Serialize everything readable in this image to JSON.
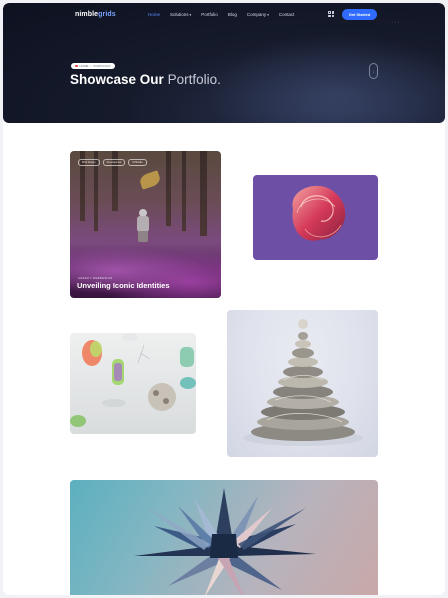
{
  "brand": {
    "name_a": "nimble",
    "name_b": "grids"
  },
  "nav": {
    "items": [
      {
        "label": "Home",
        "active": true,
        "has_menu": false
      },
      {
        "label": "Solutions",
        "active": false,
        "has_menu": true
      },
      {
        "label": "Portfolio",
        "active": false,
        "has_menu": false
      },
      {
        "label": "Blog",
        "active": false,
        "has_menu": false
      },
      {
        "label": "Company",
        "active": false,
        "has_menu": true
      },
      {
        "label": "Contact",
        "active": false,
        "has_menu": false
      }
    ],
    "cta_label": "Get Started"
  },
  "hero": {
    "breadcrumb_home": "HOME",
    "breadcrumb_sep": "/",
    "breadcrumb_current": "PORTFOLIO",
    "title_bold": "Showcase Our",
    "title_light": "Portfolio."
  },
  "portfolio": {
    "featured": {
      "tags": [
        "Web Design",
        "Development",
        "UI/Studio"
      ],
      "eyebrow": "AGENCY WEBDESIGN",
      "title": "Unveiling Iconic Identities"
    }
  },
  "colors": {
    "accent": "#2f6bff",
    "nav_active": "#5b8cff",
    "hero_bg": "#0d1120"
  }
}
